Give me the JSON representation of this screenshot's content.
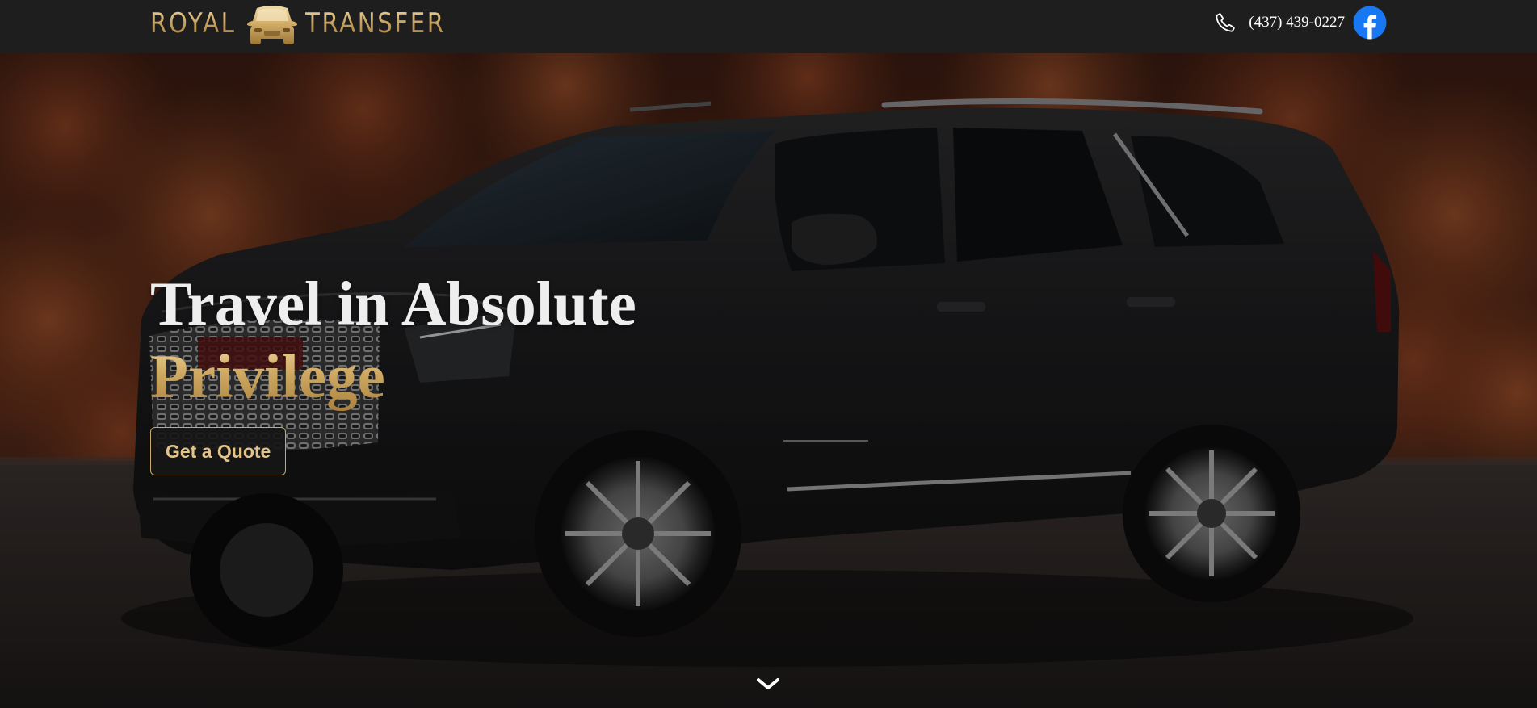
{
  "header": {
    "brand_left": "ROYAL",
    "brand_right": "TRANSFER",
    "logo_icon": "car-front-icon",
    "phone_icon": "phone-icon",
    "phone": "(437) 439-0227",
    "social_icon": "facebook-icon"
  },
  "hero": {
    "background": "black-gmc-yukon-denali-suv-autumn-trees",
    "headline_line1": "Travel in Absolute",
    "headline_line2": "Privilege",
    "cta_label": "Get a Quote",
    "scroll_icon": "chevron-down-icon"
  },
  "colors": {
    "gold": "#c9a463",
    "header_bg": "#1e1e1e",
    "facebook": "#1877f2",
    "headline_white": "#eeeeee"
  }
}
